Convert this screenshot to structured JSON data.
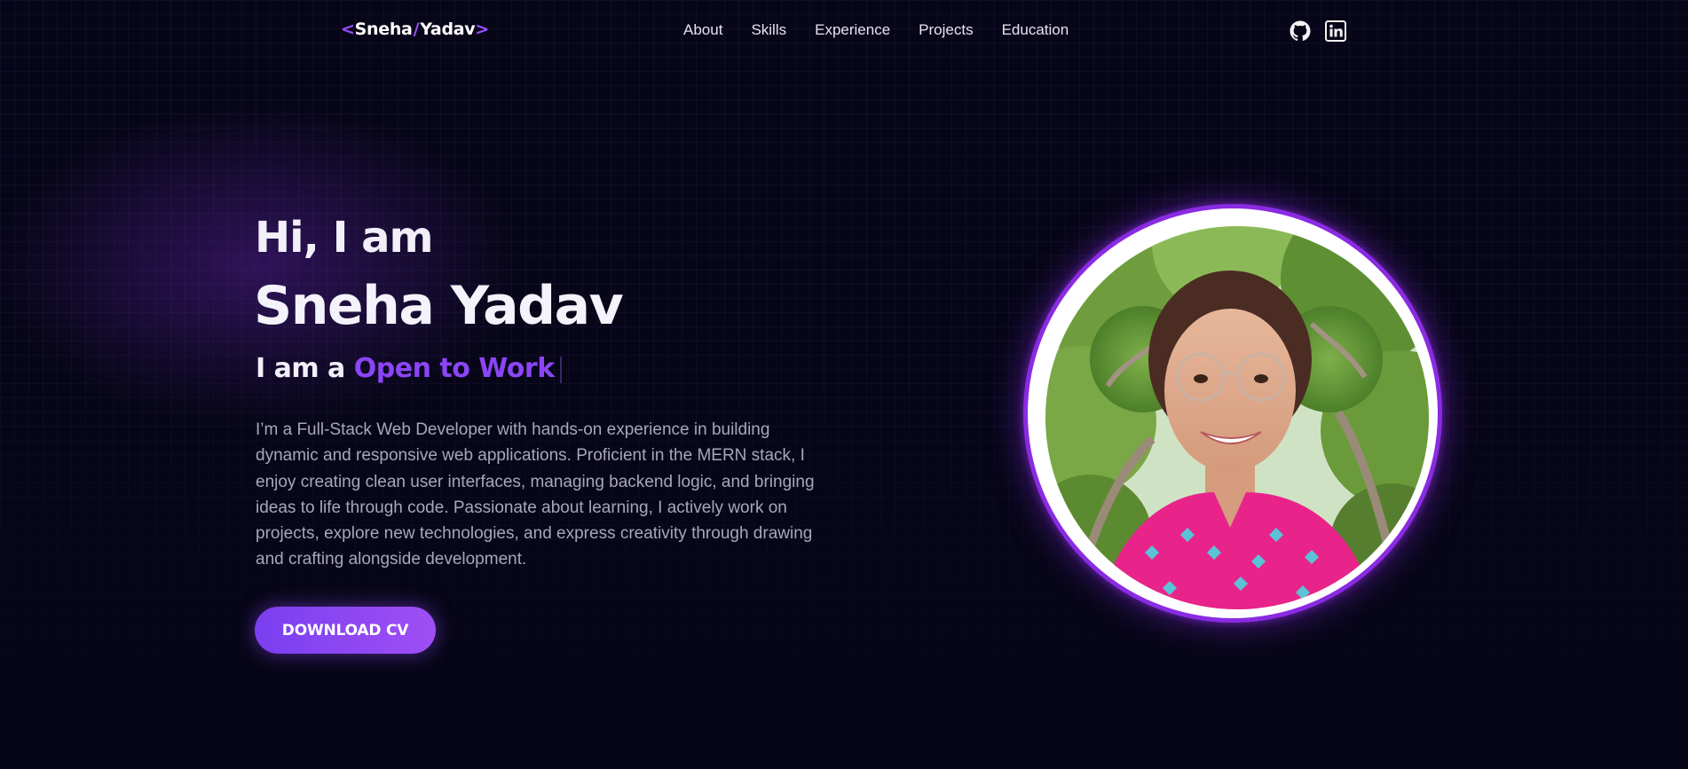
{
  "nav": {
    "logo": {
      "open_bracket": "<",
      "first": "Sneha",
      "slash": "/",
      "last": "Yadav",
      "close_bracket": ">"
    },
    "links": [
      "About",
      "Skills",
      "Experience",
      "Projects",
      "Education"
    ],
    "icons": [
      "github-icon",
      "linkedin-icon"
    ]
  },
  "hero": {
    "greeting": "Hi, I am",
    "name": "Sneha Yadav",
    "role_prefix": "I am a",
    "role_typed": "Open to Work",
    "bio": "I’m a Full-Stack Web Developer with hands-on experience in building dynamic and responsive web applications. Proficient in the MERN stack, I enjoy creating clean user interfaces, managing backend logic, and bringing ideas to life through code. Passionate about learning, I actively work on projects, explore new technologies, and express creativity through drawing and crafting alongside development.",
    "cta": "DOWNLOAD CV"
  },
  "colors": {
    "background": "#070618",
    "accent": "#8b45f5",
    "ring": "#8a2be2",
    "text": "#f1eff8",
    "muted": "#a8a6bd"
  }
}
